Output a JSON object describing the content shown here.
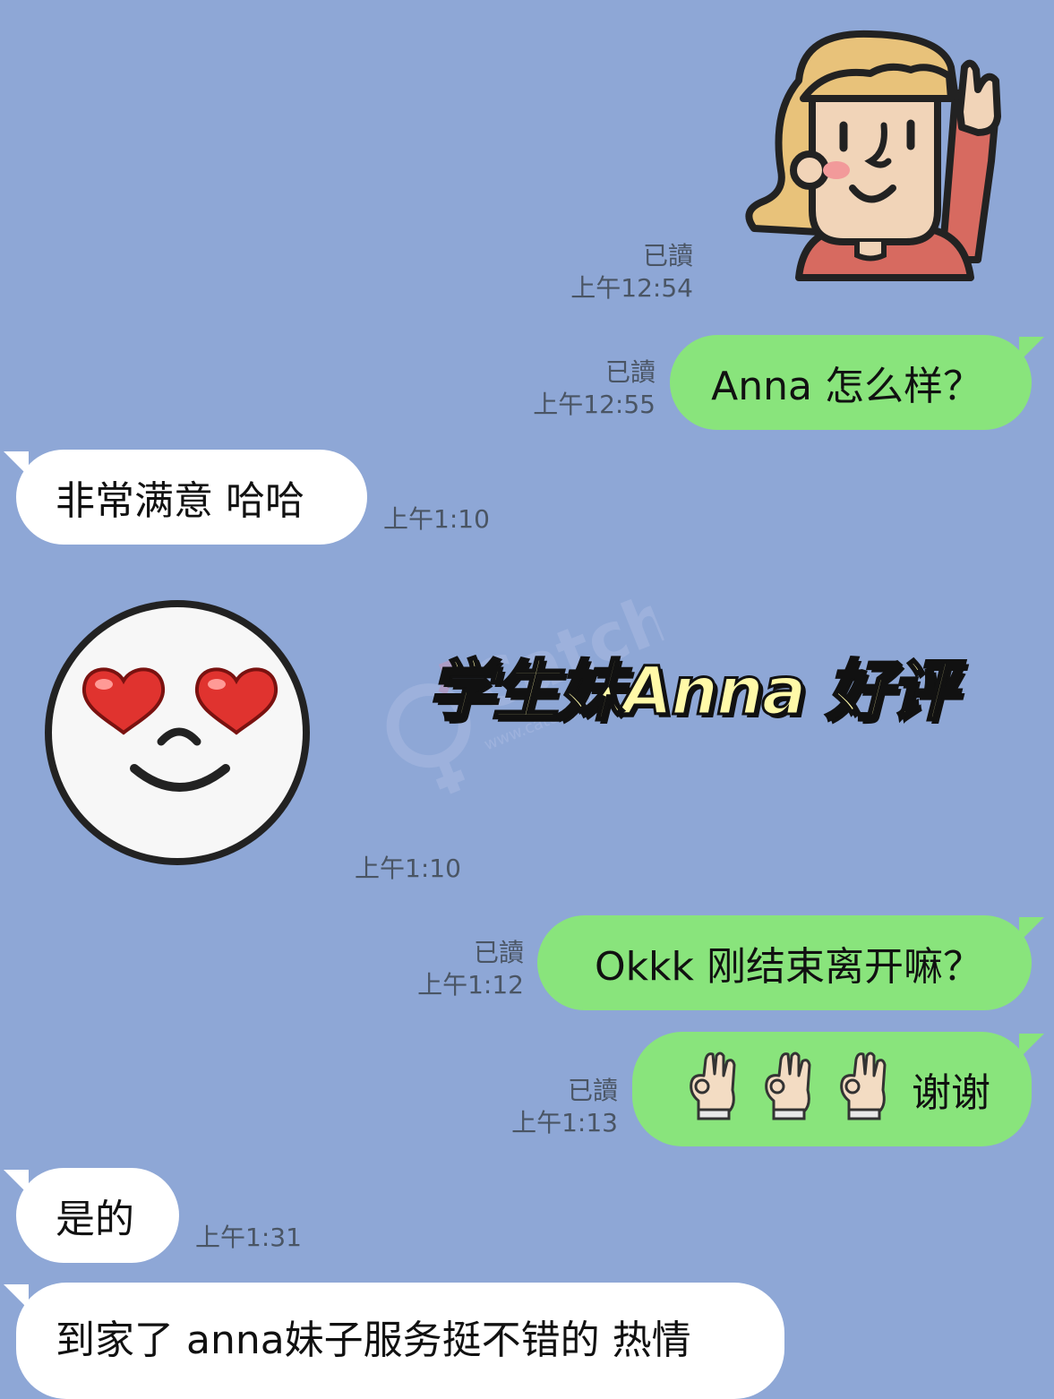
{
  "messages": [
    {
      "id": "m1",
      "dir": "out",
      "kind": "sticker",
      "sticker": "waving-person-sticker",
      "read": "已讀",
      "time": "上午12:54"
    },
    {
      "id": "m2",
      "dir": "out",
      "kind": "text",
      "text": "Anna 怎么样？",
      "read": "已讀",
      "time": "上午12:55"
    },
    {
      "id": "m3",
      "dir": "in",
      "kind": "text",
      "text": "非常满意 哈哈",
      "time": "上午1:10"
    },
    {
      "id": "m4",
      "dir": "in",
      "kind": "sticker",
      "sticker": "heart-eyes-smiley-sticker",
      "time": "上午1:10"
    },
    {
      "id": "m5",
      "dir": "out",
      "kind": "text",
      "text": "Okkk 刚结束离开嘛？",
      "read": "已讀",
      "time": "上午1:12"
    },
    {
      "id": "m6",
      "dir": "out",
      "kind": "text",
      "icons": [
        "ok-hand-icon",
        "ok-hand-icon",
        "ok-hand-icon"
      ],
      "text": "谢谢",
      "read": "已讀",
      "time": "上午1:13"
    },
    {
      "id": "m7",
      "dir": "in",
      "kind": "text",
      "text": "是的",
      "time": "上午1:31"
    },
    {
      "id": "m8",
      "dir": "in",
      "kind": "text",
      "text": "到家了 anna妹子服务挺不错的 热情"
    }
  ],
  "overlay": {
    "title": "学生妹Anna 好评"
  },
  "watermark": {
    "brand": "CatchGod",
    "url": "www.catchgod.com"
  },
  "colors": {
    "background": "#8ea7d6",
    "outgoing": "#89e47c",
    "incoming": "#ffffff",
    "meta": "#4a5564"
  }
}
